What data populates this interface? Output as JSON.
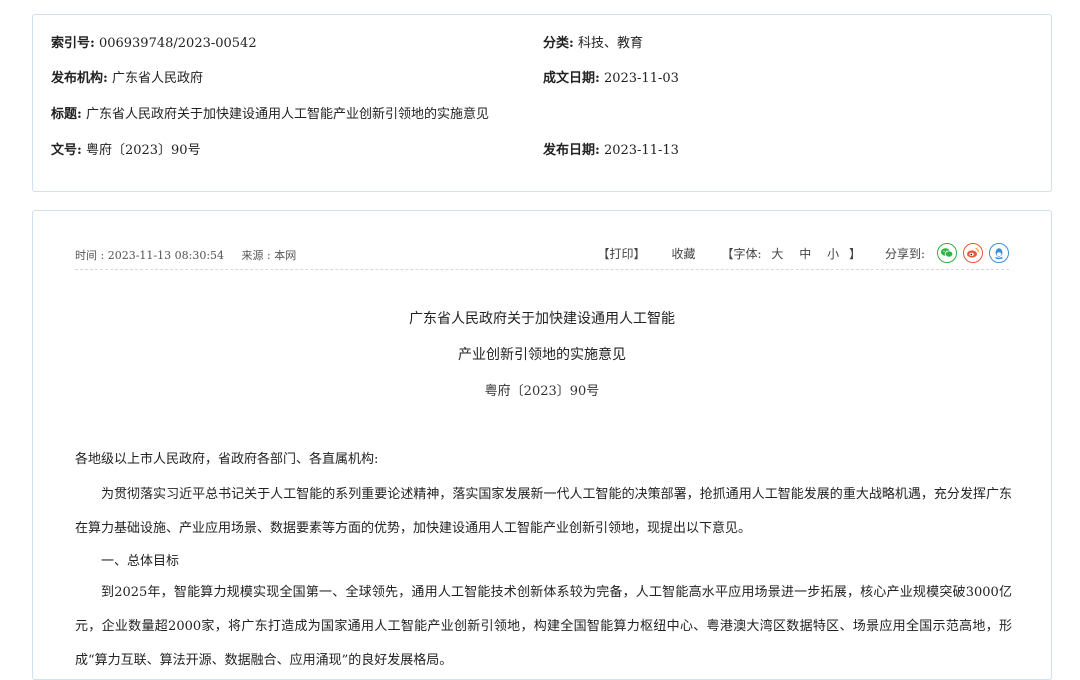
{
  "meta": {
    "index_label": "索引号:",
    "index_value": "006939748/2023-00542",
    "category_label": "分类:",
    "category_value": "科技、教育",
    "publisher_label": "发布机构:",
    "publisher_value": "广东省人民政府",
    "written_date_label": "成文日期:",
    "written_date_value": "2023-11-03",
    "title_label": "标题:",
    "title_value": "广东省人民政府关于加快建设通用人工智能产业创新引领地的实施意见",
    "doc_no_label": "文号:",
    "doc_no_value": "粤府〔2023〕90号",
    "publish_date_label": "发布日期:",
    "publish_date_value": "2023-11-13"
  },
  "toolbar": {
    "time": "时间 : 2023-11-13 08:30:54",
    "source": "来源 : 本网",
    "print": "【打印】",
    "favorite": "收藏",
    "font_prefix": "【字体:",
    "font_large": "大",
    "font_medium": "中",
    "font_small": "小",
    "font_suffix": "】",
    "share_label": "分享到:"
  },
  "article": {
    "title_line1": "广东省人民政府关于加快建设通用人工智能",
    "title_line2": "产业创新引领地的实施意见",
    "doc_number": "粤府〔2023〕90号",
    "salutation": "各地级以上市人民政府，省政府各部门、各直属机构:",
    "intro": "为贯彻落实习近平总书记关于人工智能的系列重要论述精神，落实国家发展新一代人工智能的决策部署，抢抓通用人工智能发展的重大战略机遇，充分发挥广东在算力基础设施、产业应用场景、数据要素等方面的优势，加快建设通用人工智能产业创新引领地，现提出以下意见。",
    "section1": "一、总体目标",
    "goal": "到2025年，智能算力规模实现全国第一、全球领先，通用人工智能技术创新体系较为完备，人工智能高水平应用场景进一步拓展，核心产业规模突破3000亿元，企业数量超2000家，将广东打造成为国家通用人工智能产业创新引领地，构建全国智能算力枢纽中心、粤港澳大湾区数据特区、场景应用全国示范高地，形成“算力互联、算法开源、数据融合、应用涌现”的良好发展格局。"
  }
}
